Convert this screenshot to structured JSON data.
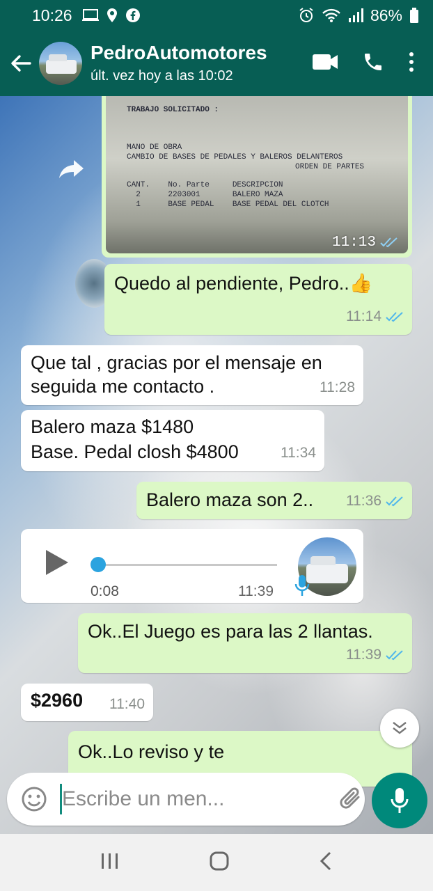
{
  "status_bar": {
    "time": "10:26",
    "battery": "86%"
  },
  "header": {
    "contact_name": "PedroAutomotores",
    "last_seen": "últ. vez hoy a las 10:02"
  },
  "messages": {
    "image": {
      "time": "11:13",
      "doc_lines": [
        "TRABAJO SOLICITADO :",
        "MANO DE OBRA",
        "CAMBIO DE BASES DE PEDALES Y BALEROS DELANTEROS",
        "ORDEN DE PARTES",
        "CANT.    No. Parte     DESCRIPCION",
        "  2      2203001       BALERO MAZA",
        "  1      BASE PEDAL    BASE PEDAL DEL CLOTCH"
      ]
    },
    "m1": {
      "text": "Quedo al pendiente, Pedro..👍",
      "time": "11:14"
    },
    "m2": {
      "line1": "Que tal , gracias por el mensaje en",
      "line2": "seguida me  contacto .",
      "time": "11:28"
    },
    "m3": {
      "line1": "Balero maza $1480",
      "line2": "Base. Pedal closh $4800",
      "time": "11:34"
    },
    "m4": {
      "text": "Balero maza son 2..",
      "time": "11:36"
    },
    "voice": {
      "duration": "0:08",
      "time": "11:39"
    },
    "m5": {
      "text": "Ok..El Juego es para las 2 llantas.",
      "time": "11:39"
    },
    "m6": {
      "text": "$2960",
      "time": "11:40"
    },
    "m7": {
      "text": "Ok..Lo reviso y te"
    }
  },
  "composer": {
    "placeholder": "Escribe un men..."
  },
  "colors": {
    "header": "#075e54",
    "outgoing_bubble": "#dcf8c6",
    "incoming_bubble": "#ffffff",
    "read_ticks": "#4fb6ec",
    "mic_button": "#00897b"
  }
}
